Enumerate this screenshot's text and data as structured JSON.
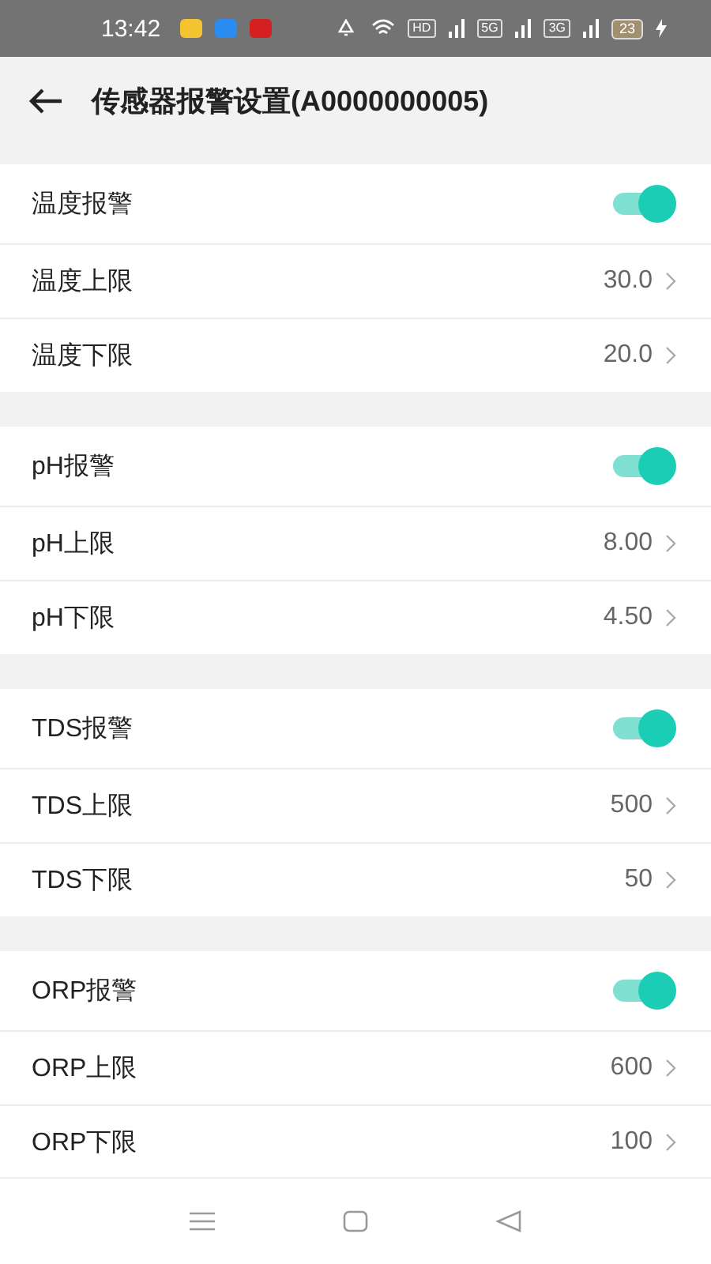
{
  "status_bar": {
    "time": "13:42",
    "network_badges": [
      "HD",
      "5G",
      "3G"
    ],
    "battery": "23"
  },
  "header": {
    "title": "传感器报警设置(A0000000005)"
  },
  "sections": [
    {
      "alarm": {
        "label": "温度报警",
        "on": true
      },
      "rows": [
        {
          "label": "温度上限",
          "value": "30.0"
        },
        {
          "label": "温度下限",
          "value": "20.0"
        }
      ]
    },
    {
      "alarm": {
        "label": "pH报警",
        "on": true
      },
      "rows": [
        {
          "label": "pH上限",
          "value": "8.00"
        },
        {
          "label": "pH下限",
          "value": "4.50"
        }
      ]
    },
    {
      "alarm": {
        "label": "TDS报警",
        "on": true
      },
      "rows": [
        {
          "label": "TDS上限",
          "value": "500"
        },
        {
          "label": "TDS下限",
          "value": "50"
        }
      ]
    },
    {
      "alarm": {
        "label": "ORP报警",
        "on": true
      },
      "rows": [
        {
          "label": "ORP上限",
          "value": "600"
        },
        {
          "label": "ORP下限",
          "value": "100"
        }
      ]
    }
  ]
}
